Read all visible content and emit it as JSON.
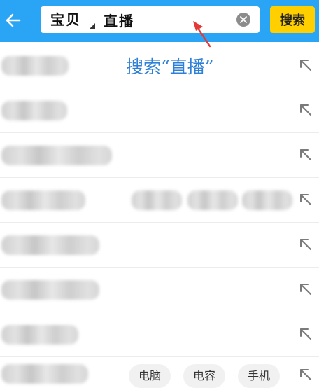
{
  "search": {
    "scope_label": "宝贝",
    "query": "直播",
    "button_label": "搜索"
  },
  "annotation": "搜索“直播”",
  "suggestion_chips": [
    "电脑",
    "电容",
    "手机"
  ],
  "colors": {
    "header_bg": "#2aa4f4",
    "search_button_bg": "#ffcf00",
    "annotation_text": "#2e7fd6",
    "annotation_arrow": "#e53935"
  },
  "icons": {
    "back": "back-arrow-icon",
    "clear": "clear-icon",
    "fill": "fill-suggestion-arrow-icon",
    "scope_toggle": "caret-icon"
  }
}
